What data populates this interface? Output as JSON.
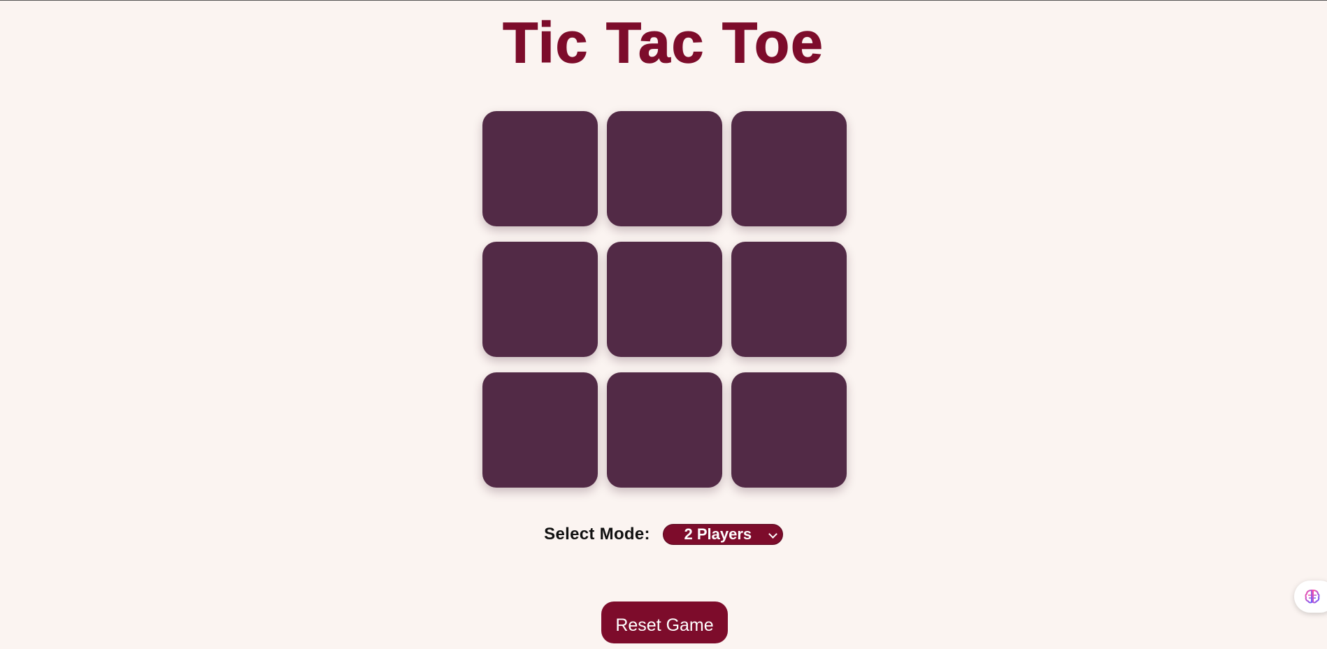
{
  "header": {
    "title": "Tic Tac Toe"
  },
  "board": {
    "cells": [
      "",
      "",
      "",
      "",
      "",
      "",
      "",
      "",
      ""
    ]
  },
  "mode": {
    "label": "Select Mode:",
    "selected": "2 Players"
  },
  "controls": {
    "reset_label": "Reset Game"
  },
  "floating": {
    "icon": "brain-icon"
  },
  "colors": {
    "background": "#fbf4f1",
    "accent": "#7d0c2b",
    "cell": "#522a46"
  }
}
